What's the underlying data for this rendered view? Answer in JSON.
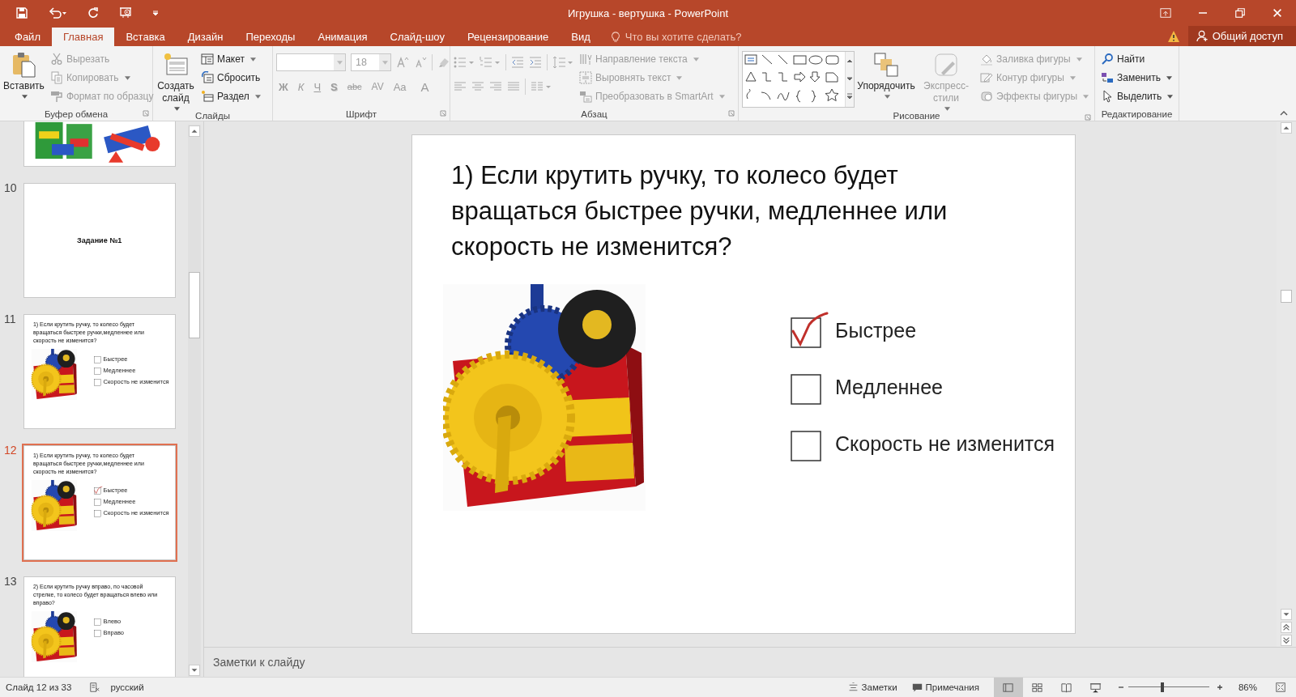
{
  "window": {
    "title": "Игрушка - вертушка - PowerPoint"
  },
  "tabs": [
    {
      "label": "Файл",
      "selected": false
    },
    {
      "label": "Главная",
      "selected": true
    },
    {
      "label": "Вставка",
      "selected": false
    },
    {
      "label": "Дизайн",
      "selected": false
    },
    {
      "label": "Переходы",
      "selected": false
    },
    {
      "label": "Анимация",
      "selected": false
    },
    {
      "label": "Слайд-шоу",
      "selected": false
    },
    {
      "label": "Рецензирование",
      "selected": false
    },
    {
      "label": "Вид",
      "selected": false
    }
  ],
  "tell_me": {
    "placeholder": "Что вы хотите сделать?"
  },
  "share_button": {
    "label": "Общий доступ"
  },
  "ribbon": {
    "groups": [
      {
        "kind": "clipboard",
        "title": "Буфер обмена",
        "large": [
          {
            "label": "Вставить",
            "disabled": false,
            "dropdown": true
          }
        ],
        "items": [
          {
            "label": "Вырезать",
            "disabled": true,
            "dropdown": false
          },
          {
            "label": "Копировать",
            "disabled": true,
            "dropdown": true
          },
          {
            "label": "Формат по образцу",
            "disabled": true,
            "dropdown": false
          }
        ]
      },
      {
        "kind": "slides",
        "title": "Слайды",
        "large": [
          {
            "label": "Создать слайд",
            "disabled": false,
            "dropdown": true
          }
        ],
        "items": [
          {
            "label": "Макет",
            "disabled": false,
            "dropdown": true
          },
          {
            "label": "Сбросить",
            "disabled": false,
            "dropdown": false
          },
          {
            "label": "Раздел",
            "disabled": false,
            "dropdown": true
          }
        ]
      },
      {
        "kind": "font",
        "title": "Шрифт",
        "font_size": {
          "value": "18",
          "disabled": true
        },
        "format_buttons": [
          {
            "label": "Ж",
            "kind": "bold",
            "disabled": true
          },
          {
            "label": "К",
            "kind": "italic",
            "disabled": true
          },
          {
            "label": "Ч",
            "kind": "underline",
            "disabled": true
          },
          {
            "label": "S",
            "kind": "shadow",
            "disabled": true
          },
          {
            "label": "abc",
            "kind": "strike",
            "disabled": true
          },
          {
            "label": "AV",
            "kind": "spacing",
            "disabled": true
          },
          {
            "label": "Aa",
            "kind": "case",
            "disabled": true
          },
          {
            "label": "A",
            "kind": "color",
            "disabled": true
          }
        ]
      },
      {
        "kind": "paragraph",
        "title": "Абзац",
        "items": [
          {
            "label": "Направление текста",
            "disabled": true,
            "dropdown": true
          },
          {
            "label": "Выровнять текст",
            "disabled": true,
            "dropdown": true
          },
          {
            "label": "Преобразовать в SmartArt",
            "disabled": true,
            "dropdown": true
          }
        ]
      },
      {
        "kind": "drawing",
        "title": "Рисование",
        "large": [
          {
            "label": "Упорядочить",
            "disabled": false,
            "dropdown": true
          },
          {
            "label": "Экспресс-стили",
            "disabled": true,
            "dropdown": true
          }
        ],
        "items": [
          {
            "label": "Заливка фигуры",
            "disabled": true,
            "dropdown": true
          },
          {
            "label": "Контур фигуры",
            "disabled": true,
            "dropdown": true
          },
          {
            "label": "Эффекты фигуры",
            "disabled": true,
            "dropdown": true
          }
        ]
      },
      {
        "kind": "editing",
        "title": "Редактирование",
        "items": [
          {
            "label": "Найти",
            "disabled": false,
            "dropdown": false
          },
          {
            "label": "Заменить",
            "disabled": false,
            "dropdown": true
          },
          {
            "label": "Выделить",
            "disabled": false,
            "dropdown": true
          }
        ]
      }
    ]
  },
  "thumbnails": [
    {
      "kind": "picture",
      "selected": false
    },
    {
      "number": "10",
      "kind": "title",
      "selected": false,
      "title": "Задание №1"
    },
    {
      "number": "11",
      "kind": "question",
      "selected": false,
      "question": "1) Если крутить ручку, то колесо будет вращаться быстрее ручки,медленнее или скорость не изменится?",
      "options": [
        {
          "label": "Быстрее",
          "checked": false
        },
        {
          "label": "Медленнее",
          "checked": false
        },
        {
          "label": "Скорость не изменится",
          "checked": false
        }
      ]
    },
    {
      "number": "12",
      "kind": "question",
      "selected": true,
      "question": "1) Если крутить ручку, то колесо будет вращаться быстрее ручки,медленнее или скорость не изменится?",
      "options": [
        {
          "label": "Быстрее",
          "checked": true
        },
        {
          "label": "Медленнее",
          "checked": false
        },
        {
          "label": "Скорость не изменится",
          "checked": false
        }
      ]
    },
    {
      "number": "13",
      "kind": "question",
      "selected": false,
      "question": "2) Если крутить ручку вправо, по часовой стрелке, то колесо будет вращаться влево или вправо?",
      "options": [
        {
          "label": "Влево",
          "checked": false
        },
        {
          "label": "Вправо",
          "checked": false
        }
      ]
    }
  ],
  "slide": {
    "kind": "question",
    "question": "1) Если крутить ручку, то колесо будет вращаться быстрее ручки, медленнее или скорость не изменится?",
    "options": [
      {
        "label": "Быстрее",
        "checked": true
      },
      {
        "label": "Медленнее",
        "checked": false
      },
      {
        "label": "Скорость не изменится",
        "checked": false
      }
    ]
  },
  "notes": {
    "placeholder": "Заметки к слайду"
  },
  "status_bar": {
    "slide_info": "Слайд 12 из 33",
    "language": "русский",
    "notes_button": "Заметки",
    "comments_button": "Примечания",
    "views": [
      {
        "kind": "normal",
        "selected": true
      },
      {
        "kind": "sorter",
        "selected": false
      },
      {
        "kind": "reading",
        "selected": false
      },
      {
        "kind": "slideshow",
        "selected": false
      }
    ],
    "zoom": {
      "level": 0.42,
      "value": "86%"
    }
  }
}
